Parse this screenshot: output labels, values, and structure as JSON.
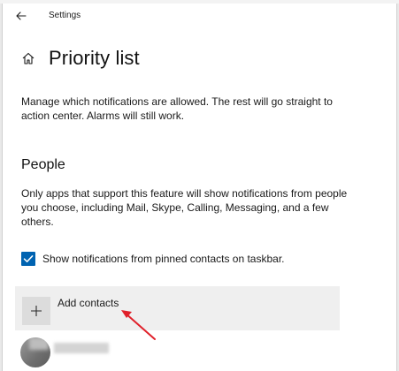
{
  "window": {
    "title": "Settings"
  },
  "page": {
    "title": "Priority list",
    "description": "Manage which notifications are allowed. The rest will go straight to action center. Alarms will still work."
  },
  "people": {
    "section_title": "People",
    "description": "Only apps that support this feature will show notifications from people you choose, including Mail, Skype, Calling, Messaging, and a few others.",
    "pinned_contacts_checkbox": {
      "label": "Show notifications from pinned contacts on taskbar.",
      "checked": true
    },
    "add_contacts_label": "Add contacts"
  },
  "icons": {
    "back": "back-arrow-icon",
    "home": "home-icon",
    "plus": "plus-icon",
    "check": "checkmark-icon"
  },
  "colors": {
    "accent": "#0063b1",
    "annotation_arrow": "#e0202a",
    "add_button_bg": "#efefef"
  }
}
